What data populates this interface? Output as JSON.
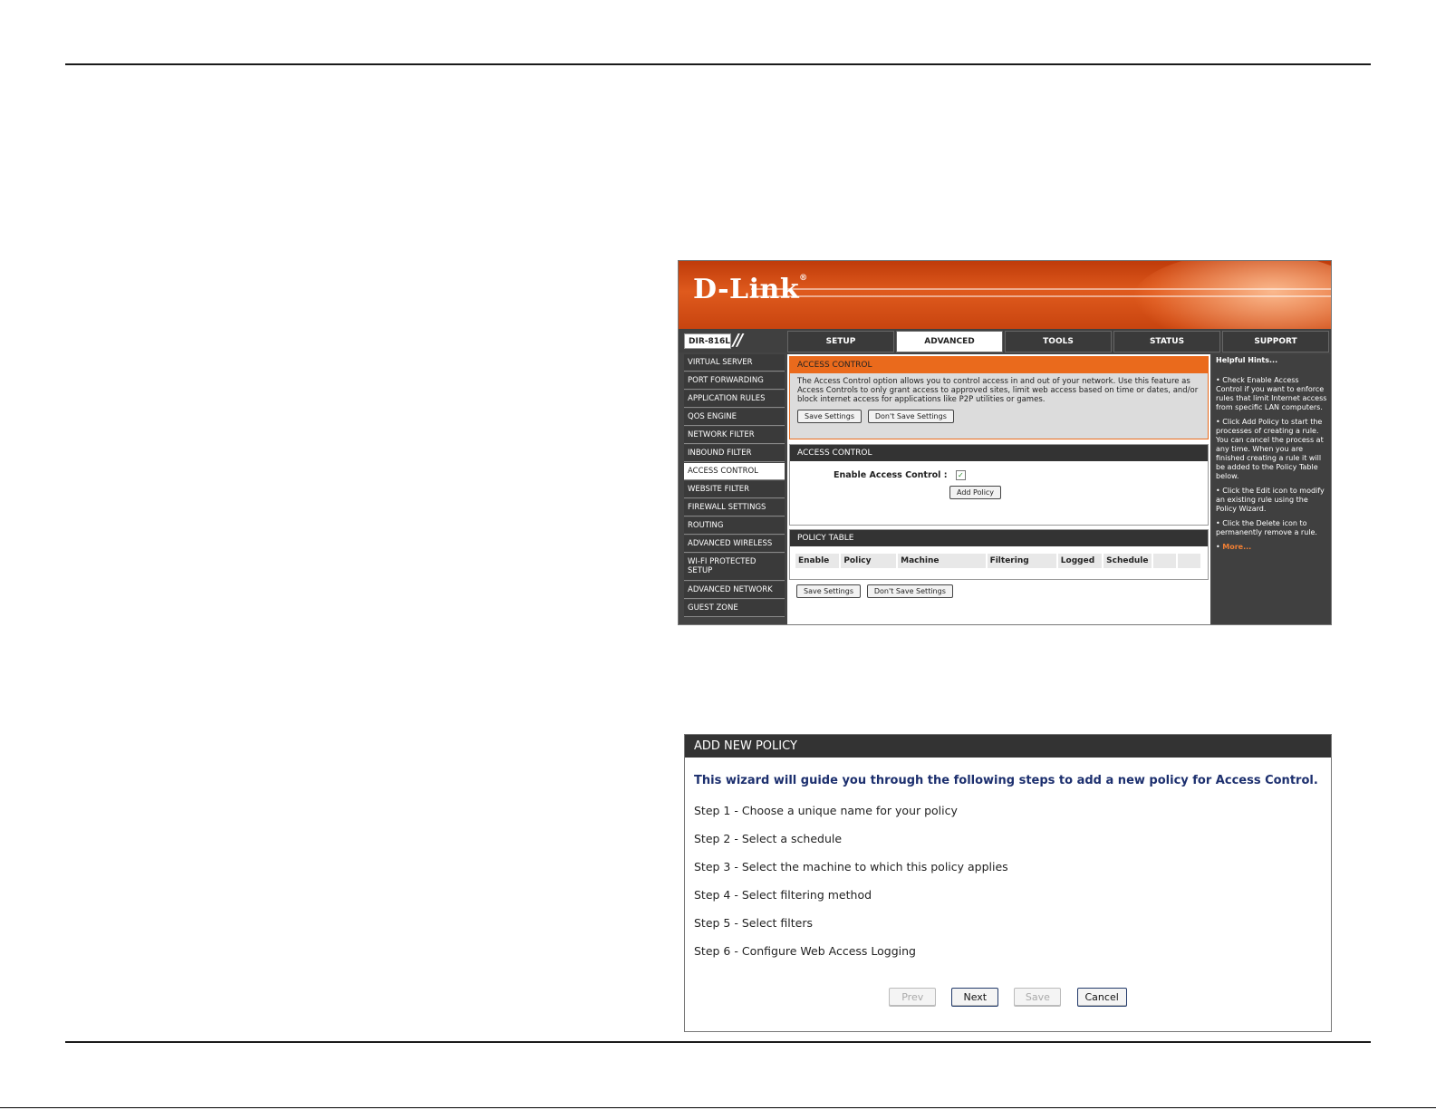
{
  "router": {
    "logo": "D-Link",
    "model": "DIR-816L",
    "tabs": [
      "SETUP",
      "ADVANCED",
      "TOOLS",
      "STATUS",
      "SUPPORT"
    ],
    "active_tab": "ADVANCED",
    "sidebar": [
      "VIRTUAL SERVER",
      "PORT FORWARDING",
      "APPLICATION RULES",
      "QOS ENGINE",
      "NETWORK FILTER",
      "INBOUND FILTER",
      "ACCESS CONTROL",
      "WEBSITE FILTER",
      "FIREWALL SETTINGS",
      "ROUTING",
      "ADVANCED WIRELESS",
      "WI-FI PROTECTED SETUP",
      "ADVANCED NETWORK",
      "GUEST ZONE"
    ],
    "active_sidebar": "ACCESS CONTROL",
    "intro": {
      "title": "ACCESS CONTROL",
      "text": "The Access Control option allows you to control access in and out of your network. Use this feature as Access Controls to only grant access to approved sites, limit web access based on time or dates, and/or block internet access for applications like P2P utilities or games.",
      "save_label": "Save Settings",
      "dont_save_label": "Don't Save Settings"
    },
    "access_control": {
      "title": "ACCESS CONTROL",
      "enable_label": "Enable Access Control :",
      "enabled": true,
      "add_policy_label": "Add Policy"
    },
    "policy_table": {
      "title": "POLICY TABLE",
      "columns": [
        "Enable",
        "Policy",
        "Machine",
        "Filtering",
        "Logged",
        "Schedule",
        "",
        ""
      ]
    },
    "bottom_buttons": {
      "save_label": "Save Settings",
      "dont_save_label": "Don't Save Settings"
    },
    "hints": {
      "title": "Helpful Hints...",
      "items": [
        "Check Enable Access Control if you want to enforce rules that limit Internet access from specific LAN computers.",
        "Click Add Policy to start the processes of creating a rule. You can cancel the process at any time. When you are finished creating a rule it will be added to the Policy Table below.",
        "Click the Edit icon to modify an existing rule using the Policy Wizard.",
        "Click the Delete icon to permanently remove a rule."
      ],
      "more": "More..."
    }
  },
  "dialog": {
    "title": "ADD NEW POLICY",
    "lead": "This wizard will guide you through the following steps to add a new policy for Access Control.",
    "steps": [
      "Step 1 - Choose a unique name for your policy",
      "Step 2 - Select a schedule",
      "Step 3 - Select the machine to which this policy applies",
      "Step 4 - Select filtering method",
      "Step 5 - Select filters",
      "Step 6 - Configure Web Access Logging"
    ],
    "buttons": {
      "prev": "Prev",
      "next": "Next",
      "save": "Save",
      "cancel": "Cancel"
    }
  }
}
